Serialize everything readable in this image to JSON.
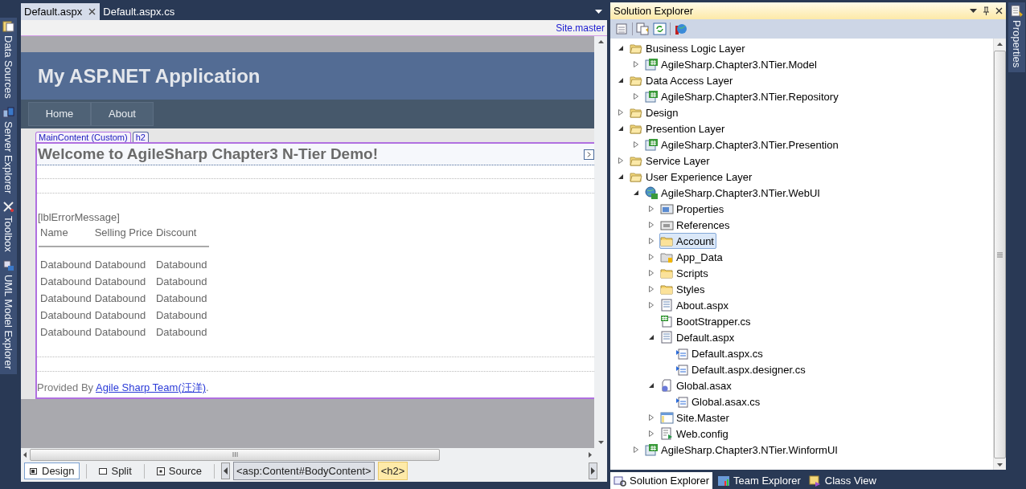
{
  "left_tool_tabs": [
    {
      "label": "Data Sources",
      "kind": "data"
    },
    {
      "label": "Server Explorer",
      "kind": "server"
    },
    {
      "label": "Toolbox",
      "kind": "toolbox"
    },
    {
      "label": "UML Model Explorer",
      "kind": "uml"
    }
  ],
  "document_tabs": [
    {
      "label": "Default.aspx",
      "selected": true
    },
    {
      "label": "Default.aspx.cs",
      "selected": false
    }
  ],
  "designer": {
    "master_link": "Site.master",
    "site_title": "My ASP.NET Application",
    "menu": [
      "Home",
      "About"
    ],
    "content_tag": "MainContent (Custom)",
    "element_tag": "h2",
    "heading": "Welcome to AgileSharp Chapter3 N-Tier Demo!",
    "error_label": "[lblErrorMessage]",
    "grid": {
      "columns": [
        "Name",
        "Selling Price",
        "Discount"
      ],
      "rows": [
        [
          "Databound",
          "Databound",
          "Databound"
        ],
        [
          "Databound",
          "Databound",
          "Databound"
        ],
        [
          "Databound",
          "Databound",
          "Databound"
        ],
        [
          "Databound",
          "Databound",
          "Databound"
        ],
        [
          "Databound",
          "Databound",
          "Databound"
        ]
      ]
    },
    "footer": {
      "text": "Provided By ",
      "link": "Agile Sharp Team(汪洋)",
      "after": "."
    }
  },
  "view_tabs": [
    {
      "label": "Design",
      "kind": "design",
      "selected": true
    },
    {
      "label": "Split",
      "kind": "split",
      "selected": false
    },
    {
      "label": "Source",
      "kind": "source",
      "selected": false
    }
  ],
  "breadcrumb": [
    {
      "label": "<asp:Content#BodyContent>",
      "selected": false
    },
    {
      "label": "<h2>",
      "selected": true
    }
  ],
  "solution_explorer": {
    "title": "Solution Explorer",
    "tree": [
      {
        "label": "Business Logic Layer",
        "kind": "solution-folder",
        "expanded": true,
        "selected": false,
        "children": [
          {
            "label": "AgileSharp.Chapter3.NTier.Model",
            "kind": "cs-project",
            "expanded": false,
            "selected": false
          }
        ]
      },
      {
        "label": "Data Access Layer",
        "kind": "solution-folder",
        "expanded": true,
        "selected": false,
        "children": [
          {
            "label": "AgileSharp.Chapter3.NTier.Repository",
            "kind": "cs-project",
            "expanded": false,
            "selected": false
          }
        ]
      },
      {
        "label": "Design",
        "kind": "solution-folder",
        "expanded": false,
        "selected": false
      },
      {
        "label": "Presention Layer",
        "kind": "solution-folder",
        "expanded": true,
        "selected": false,
        "children": [
          {
            "label": "AgileSharp.Chapter3.NTier.Presention",
            "kind": "cs-project",
            "expanded": false,
            "selected": false
          }
        ]
      },
      {
        "label": "Service Layer",
        "kind": "solution-folder",
        "expanded": false,
        "selected": false
      },
      {
        "label": "User Experience Layer",
        "kind": "solution-folder",
        "expanded": true,
        "selected": false,
        "children": [
          {
            "label": "AgileSharp.Chapter3.NTier.WebUI",
            "kind": "web-project",
            "expanded": true,
            "selected": false,
            "children": [
              {
                "label": "Properties",
                "kind": "properties",
                "expanded": false,
                "selected": false
              },
              {
                "label": "References",
                "kind": "references",
                "expanded": false,
                "selected": false
              },
              {
                "label": "Account",
                "kind": "folder",
                "expanded": false,
                "selected": true
              },
              {
                "label": "App_Data",
                "kind": "data-folder",
                "expanded": false,
                "selected": false
              },
              {
                "label": "Scripts",
                "kind": "folder",
                "expanded": false,
                "selected": false
              },
              {
                "label": "Styles",
                "kind": "folder",
                "expanded": false,
                "selected": false
              },
              {
                "label": "About.aspx",
                "kind": "page",
                "expanded": false,
                "selected": false
              },
              {
                "label": "BootStrapper.cs",
                "kind": "cs-file",
                "selected": false
              },
              {
                "label": "Default.aspx",
                "kind": "page",
                "expanded": true,
                "selected": false,
                "children": [
                  {
                    "label": "Default.aspx.cs",
                    "kind": "code-file",
                    "selected": false
                  },
                  {
                    "label": "Default.aspx.designer.cs",
                    "kind": "code-file",
                    "selected": false
                  }
                ]
              },
              {
                "label": "Global.asax",
                "kind": "asax",
                "expanded": true,
                "selected": false,
                "children": [
                  {
                    "label": "Global.asax.cs",
                    "kind": "code-file",
                    "selected": false
                  }
                ]
              },
              {
                "label": "Site.Master",
                "kind": "master",
                "expanded": false,
                "selected": false
              },
              {
                "label": "Web.config",
                "kind": "config",
                "expanded": false,
                "selected": false
              }
            ]
          },
          {
            "label": "AgileSharp.Chapter3.NTier.WinformUI",
            "kind": "cs-project",
            "expanded": false,
            "selected": false
          }
        ]
      }
    ]
  },
  "explorer_tabs": [
    {
      "label": "Solution Explorer",
      "kind": "solution",
      "selected": true
    },
    {
      "label": "Team Explorer",
      "kind": "team",
      "selected": false
    },
    {
      "label": "Class View",
      "kind": "class",
      "selected": false
    }
  ],
  "right_tool_tabs": [
    {
      "label": "Properties",
      "kind": "properties"
    }
  ]
}
